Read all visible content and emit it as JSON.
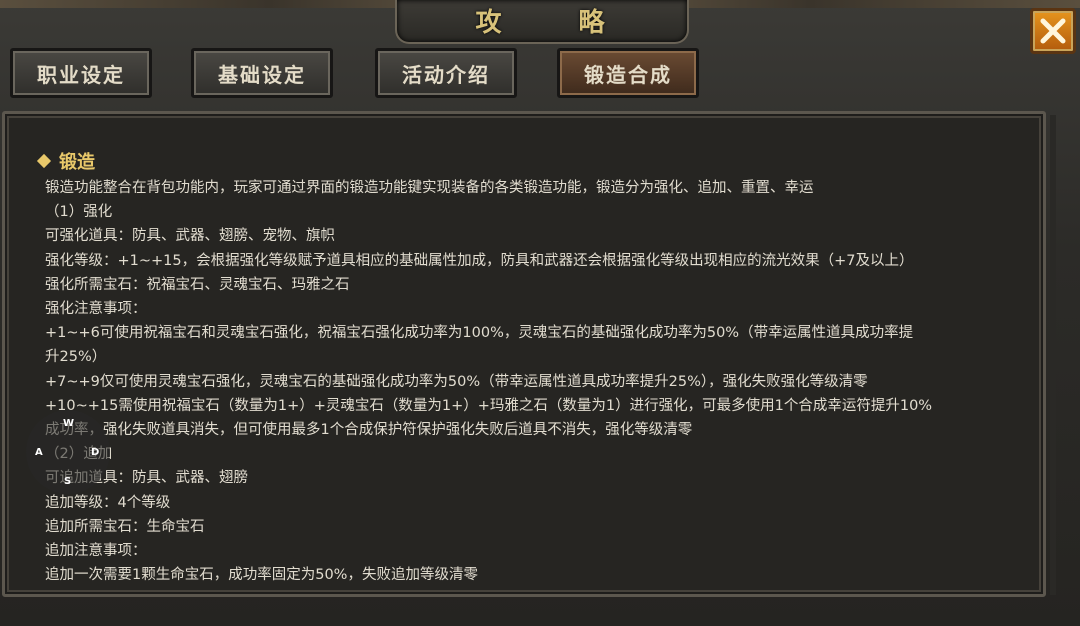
{
  "window": {
    "title": "攻 略"
  },
  "tabs": [
    {
      "label": "职业设定",
      "active": false
    },
    {
      "label": "基础设定",
      "active": false
    },
    {
      "label": "活动介绍",
      "active": false
    },
    {
      "label": "锻造合成",
      "active": true
    }
  ],
  "section": {
    "heading": "锻造",
    "lines": [
      "锻造功能整合在背包功能内，玩家可通过界面的锻造功能键实现装备的各类锻造功能，锻造分为强化、追加、重置、幸运",
      "（1）强化",
      "可强化道具：防具、武器、翅膀、宠物、旗帜",
      "强化等级：+1~+15，会根据强化等级赋予道具相应的基础属性加成，防具和武器还会根据强化等级出现相应的流光效果（+7及以上）",
      "强化所需宝石：祝福宝石、灵魂宝石、玛雅之石",
      "强化注意事项：",
      "+1~+6可使用祝福宝石和灵魂宝石强化，祝福宝石强化成功率为100%，灵魂宝石的基础强化成功率为50%（带幸运属性道具成功率提",
      "升25%）",
      "+7~+9仅可使用灵魂宝石强化，灵魂宝石的基础强化成功率为50%（带幸运属性道具成功率提升25%），强化失败强化等级清零",
      "+10~+15需使用祝福宝石（数量为1+）+灵魂宝石（数量为1+）+玛雅之石（数量为1）进行强化，可最多使用1个合成幸运符提升10%",
      "成功率，强化失败道具消失，但可使用最多1个合成保护符保护强化失败后道具不消失，强化等级清零",
      "（2）追加",
      "可追加道具：防具、武器、翅膀",
      "追加等级：4个等级",
      "追加所需宝石：生命宝石",
      "追加注意事项：",
      "追加一次需要1颗生命宝石，成功率固定为50%，失败追加等级清零"
    ]
  },
  "joystick": {
    "up": "W",
    "left": "A",
    "right": "D",
    "down": "S"
  },
  "colors": {
    "heading": "#e8c86a",
    "title": "#d8c27a",
    "text": "#e1dccf",
    "close": "#e6951e"
  },
  "icons": {
    "close": "close-x-icon",
    "bullet": "diamond-bullet-icon"
  }
}
